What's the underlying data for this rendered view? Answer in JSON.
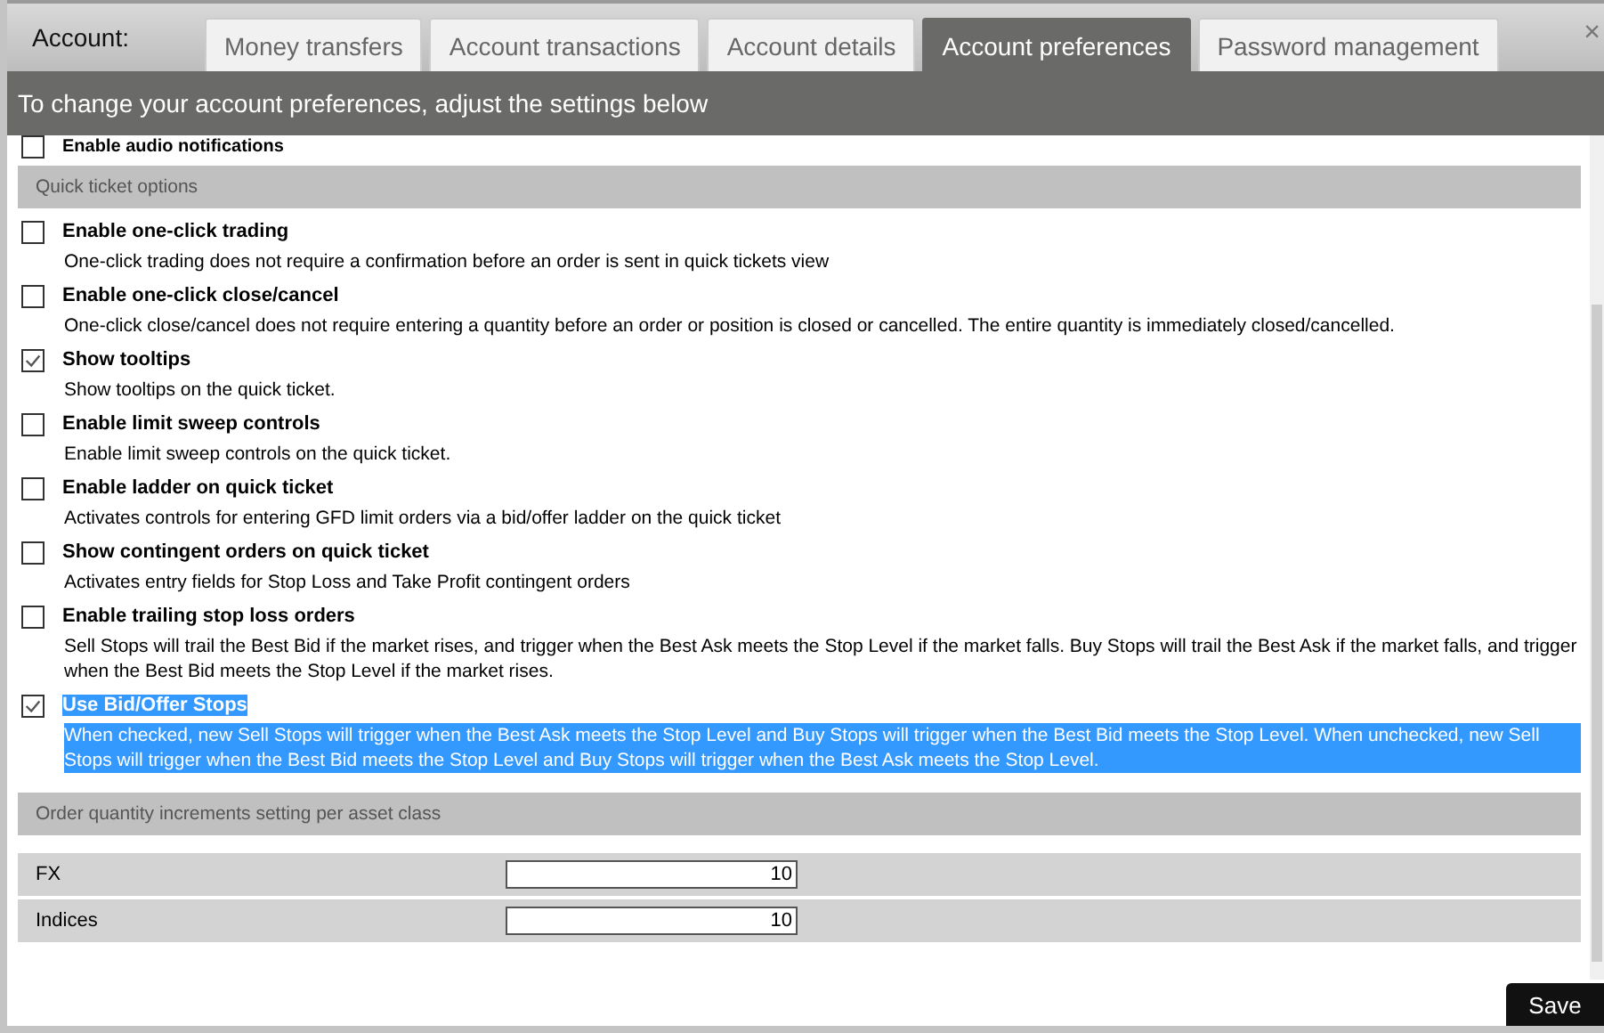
{
  "header": {
    "label": "Account:",
    "close": "×"
  },
  "tabs": [
    {
      "label": "Money transfers",
      "selected": false
    },
    {
      "label": "Account transactions",
      "selected": false
    },
    {
      "label": "Account details",
      "selected": false
    },
    {
      "label": "Account preferences",
      "selected": true
    },
    {
      "label": "Password management",
      "selected": false
    }
  ],
  "banner": "To change your account preferences, adjust the settings below",
  "top_option": {
    "title": "Enable audio notifications",
    "checked": false
  },
  "sections": [
    {
      "title": "Quick ticket options",
      "options": [
        {
          "title": "Enable one-click trading",
          "description": "One-click trading does not require a confirmation before an order is sent in quick tickets view",
          "checked": false,
          "highlighted": false
        },
        {
          "title": "Enable one-click close/cancel",
          "description": "One-click close/cancel does not require entering a quantity before an order or position is closed or cancelled. The entire quantity is immediately closed/cancelled.",
          "checked": false,
          "highlighted": false
        },
        {
          "title": "Show tooltips",
          "description": "Show tooltips on the quick ticket.",
          "checked": true,
          "highlighted": false
        },
        {
          "title": "Enable limit sweep controls",
          "description": "Enable limit sweep controls on the quick ticket.",
          "checked": false,
          "highlighted": false
        },
        {
          "title": "Enable ladder on quick ticket",
          "description": "Activates controls for entering GFD limit orders via a bid/offer ladder on the quick ticket",
          "checked": false,
          "highlighted": false
        },
        {
          "title": "Show contingent orders on quick ticket",
          "description": "Activates entry fields for Stop Loss and Take Profit contingent orders",
          "checked": false,
          "highlighted": false
        },
        {
          "title": "Enable trailing stop loss orders",
          "description": "Sell Stops will trail the Best Bid if the market rises, and trigger when the Best Ask meets the Stop Level if the market falls. Buy Stops will trail the Best Ask if the market falls, and trigger when the Best Bid meets the Stop Level if the market rises.",
          "checked": false,
          "highlighted": false
        },
        {
          "title": "Use Bid/Offer Stops",
          "description": "When checked, new Sell Stops will trigger when the Best Ask meets the Stop Level and Buy Stops will trigger when the Best Bid meets the Stop Level. When unchecked, new Sell Stops will trigger when the Best Bid meets the Stop Level and Buy Stops will trigger when the Best Ask meets the Stop Level.",
          "checked": true,
          "highlighted": true
        }
      ]
    }
  ],
  "increments": {
    "title": "Order quantity increments setting per asset class",
    "rows": [
      {
        "label": "FX",
        "value": "10"
      },
      {
        "label": "Indices",
        "value": "10"
      }
    ]
  },
  "save_button": "Save"
}
